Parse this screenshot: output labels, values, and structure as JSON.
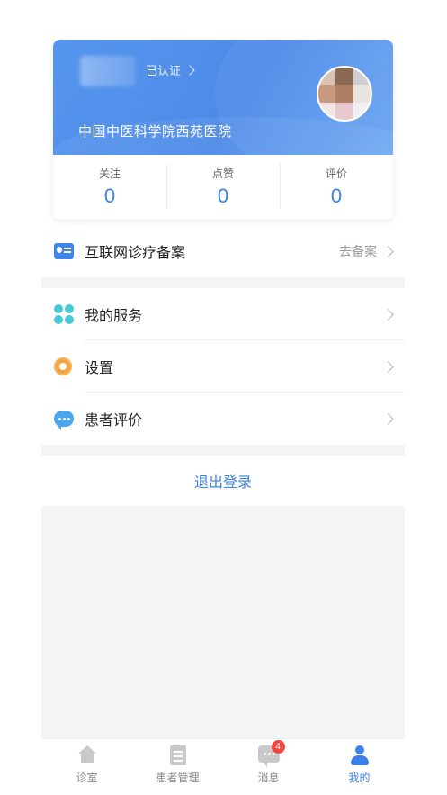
{
  "profile": {
    "cert_label": "已认证",
    "hospital": "中国中医科学院西苑医院",
    "stats": [
      {
        "label": "关注",
        "value": "0"
      },
      {
        "label": "点赞",
        "value": "0"
      },
      {
        "label": "评价",
        "value": "0"
      }
    ]
  },
  "record": {
    "label": "互联网诊疗备案",
    "action": "去备案"
  },
  "menu": {
    "items": [
      {
        "label": "我的服务",
        "icon": "service-icon"
      },
      {
        "label": "设置",
        "icon": "gear-icon"
      },
      {
        "label": "患者评价",
        "icon": "chat-icon"
      }
    ]
  },
  "logout_label": "退出登录",
  "tabbar": {
    "tabs": [
      {
        "label": "诊室",
        "icon": "home-icon"
      },
      {
        "label": "患者管理",
        "icon": "patient-icon"
      },
      {
        "label": "消息",
        "icon": "message-icon",
        "badge": "4"
      },
      {
        "label": "我的",
        "icon": "profile-icon"
      }
    ]
  },
  "colors": {
    "accent": "#3a82e6",
    "header_blue": "#4d8ae8",
    "badge_red": "#f2463e"
  }
}
